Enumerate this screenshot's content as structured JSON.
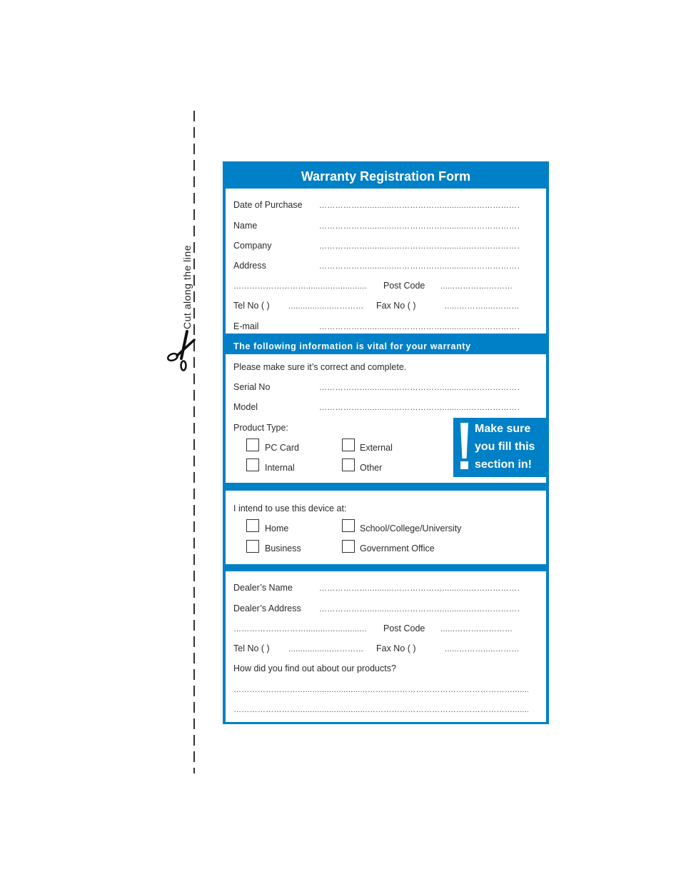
{
  "cut_guide": {
    "text": "Cut along the line",
    "icon": "scissors-icon"
  },
  "form": {
    "title": "Warranty Registration Form",
    "brand_color": "#0080c6",
    "customer": {
      "date_of_purchase": "Date of Purchase",
      "name": "Name",
      "company": "Company",
      "address": "Address",
      "post_code": "Post Code",
      "tel_no": "Tel  No (    )",
      "fax_no": "Fax No (    )",
      "email": "E-mail"
    },
    "vital_banner": "The following information is vital for your warranty",
    "product": {
      "note": "Please make sure it’s correct and complete.",
      "serial_no": "Serial No",
      "model": "Model",
      "product_type_label": "Product Type:",
      "types": [
        "PC Card",
        "External",
        "Internal",
        "Other"
      ]
    },
    "alert": {
      "icon": "exclamation-icon",
      "lines": [
        "Make  sure",
        "you fill this",
        "section in!"
      ]
    },
    "usage": {
      "label": "I intend to use this device at:",
      "options": [
        "Home",
        "School/College/University",
        "Business",
        "Government  Office"
      ]
    },
    "dealer": {
      "name": "Dealer’s Name",
      "address": "Dealer’s Address",
      "post_code": "Post Code",
      "tel_no": "Tel  No (    )",
      "fax_no": "Fax No (    )",
      "question": "How did you find out about our products?"
    },
    "fill_lines": {
      "long": "………………...........………………...........………………….........................",
      "address_cont": "……………………….........….............",
      "post_code": "......………....………",
      "tel": "..................…………",
      "fax": "......……….....………",
      "full": "…………………….............................……………………………………………….......……………"
    }
  }
}
